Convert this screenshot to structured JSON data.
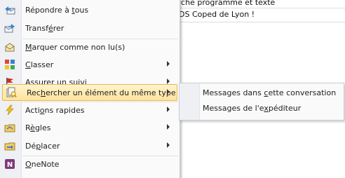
{
  "background_rows": [
    {
      "text": "iche programme et texte"
    },
    {
      "text": "DS Coped de Lyon !"
    }
  ],
  "menu": {
    "items": [
      {
        "label": "Répondre à tous",
        "icon": "reply-all-icon"
      },
      {
        "label": "Transférer",
        "icon": "forward-icon"
      },
      {
        "label": "Marquer comme non lu(s)",
        "icon": "mark-unread-icon"
      },
      {
        "label": "Classer",
        "icon": "categorize-icon"
      },
      {
        "label": "Assurer un suivi",
        "icon": "flag-icon"
      },
      {
        "label": "Rechercher un élément du même type",
        "icon": "find-related-icon"
      },
      {
        "label": "Actions rapides",
        "icon": "lightning-icon"
      },
      {
        "label": "Règles",
        "icon": "rules-icon"
      },
      {
        "label": "Déplacer",
        "icon": "move-icon"
      },
      {
        "label": "OneNote",
        "icon": "onenote-icon"
      }
    ]
  },
  "submenu": {
    "items": [
      {
        "label": "Messages dans cette conversation"
      },
      {
        "label": "Messages de l'expéditeur"
      }
    ]
  },
  "colors": {
    "highlight_top": "#fff4cf",
    "highlight_bottom": "#ffe39b",
    "highlight_border": "#e6b84f",
    "gutter": "#eef0f3"
  }
}
